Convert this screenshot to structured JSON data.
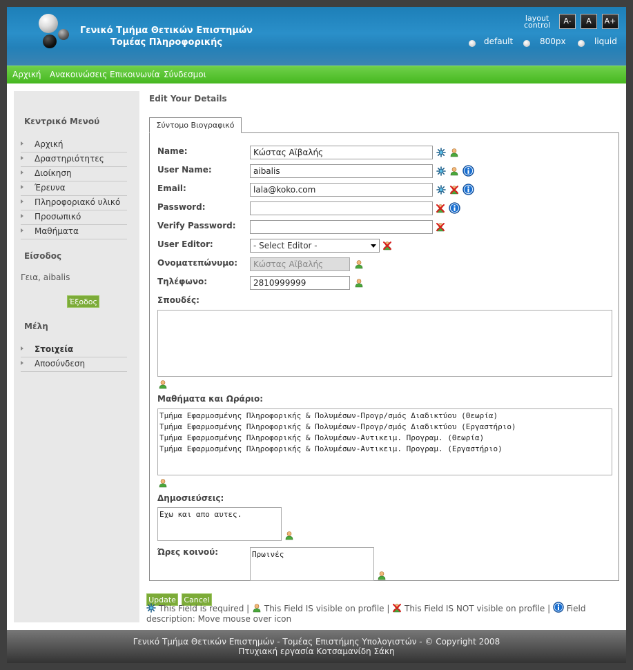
{
  "header": {
    "title_line1": "Γενικό Τμήμα Θετικών Επιστημών",
    "title_line2": "Τομέας Πληροφορικής",
    "layout_control_line1": "layout",
    "layout_control_line2": "control",
    "font_buttons": [
      "A-",
      "A",
      "A+"
    ],
    "layout_options": [
      "default",
      "800px",
      "liquid"
    ]
  },
  "nav": {
    "items": [
      "Αρχική",
      "Ανακοινώσεις",
      "Επικοινωνία",
      "Σύνδεσμοι"
    ]
  },
  "sidebar": {
    "menu_heading": "Κεντρικό Μενού",
    "menu_items": [
      "Αρχική",
      "Δραστηριότητες",
      "Διοίκηση",
      "Έρευνα",
      "Πληροφοριακό υλικό",
      "Προσωπικό",
      "Μαθήματα"
    ],
    "login_heading": "Είσοδος",
    "greeting": "Γεια, aibalis",
    "logout_label": "Έξοδος",
    "members_heading": "Μέλη",
    "member_items": [
      "Στοιχεία",
      "Αποσύνδεση"
    ]
  },
  "main": {
    "title": "Edit Your Details",
    "tab_label": "Σύντομο Βιογραφικό",
    "fields": {
      "name_label": "Name:",
      "name_value": "Κώστας Αϊβαλής",
      "username_label": "User Name:",
      "username_value": "aibalis",
      "email_label": "Email:",
      "email_value": "lala@koko.com",
      "password_label": "Password:",
      "password_value": "",
      "verify_label": "Verify Password:",
      "verify_value": "",
      "editor_label": "User Editor:",
      "editor_value": "- Select Editor -",
      "fullname_label": "Ονοματεπώνυμο:",
      "fullname_value": "Κώστας Αϊβαλής",
      "phone_label": "Τηλέφωνο:",
      "phone_value": "2810999999",
      "studies_label": "Σπουδές:",
      "studies_value": "",
      "courses_label": "Μαθήματα και Ωράριο:",
      "courses_lines": [
        "Τμήμα Εφαρμοσμένης Πληροφορικής & Πολυμέσων-Προγρ/σμός Διαδικτύου (Θεωρία)",
        "Τμήμα Εφαρμοσμένης Πληροφορικής & Πολυμέσων-Προγρ/σμός Διαδικτύου (Εργαστήριο)",
        "Τμήμα Εφαρμοσμένης Πληροφορικής & Πολυμέσων-Αντικειμ. Προγραμ. (Θεωρία)",
        "Τμήμα Εφαρμοσμένης Πληροφορικής & Πολυμέσων-Αντικειμ. Προγραμ. (Εργαστήριο)"
      ],
      "publications_label": "Δημοσιεύσεις:",
      "publications_value": "Εχω και απο αυτες.",
      "hours_label": "Ώρες κοινού:",
      "hours_value": "Πρωινές"
    },
    "update_label": "Update",
    "cancel_label": "Cancel",
    "legend": {
      "required": "This Field is required |",
      "visible": "This Field IS visible on profile |",
      "not_visible": "This Field IS NOT visible on profile |",
      "description": "Field description: Move mouse over icon"
    }
  },
  "footer": {
    "line1": "Γενικό Τμήμα Θετικών Επιστημών - Τομέας Επιστήμης Υπολογιστών - © Copyright 2008",
    "line2": "Πτυχιακή εργασία Κοτσαμανίδη Σάκη"
  },
  "colors": {
    "header_blue": "#1d7fb8",
    "nav_green": "#46b820",
    "button_green": "#7cab38",
    "info_blue": "#1a6fd0"
  }
}
